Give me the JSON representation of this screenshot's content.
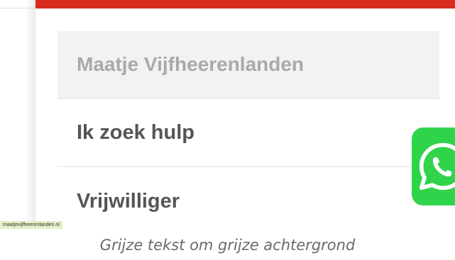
{
  "menu": {
    "items": [
      {
        "label": "Maatje Vijfheerenlanden",
        "active": true
      },
      {
        "label": "Ik zoek hulp",
        "active": false
      },
      {
        "label": "Vrijwilliger",
        "active": false
      }
    ]
  },
  "floating": {
    "icon": "whatsapp-icon",
    "color": "#2fd44b"
  },
  "accent": {
    "top_bar_color": "#d62b1e"
  },
  "watermark": {
    "text": "maatjevijfheerenlanden.nl"
  },
  "caption": {
    "text": "Grijze tekst om grijze achtergrond"
  }
}
